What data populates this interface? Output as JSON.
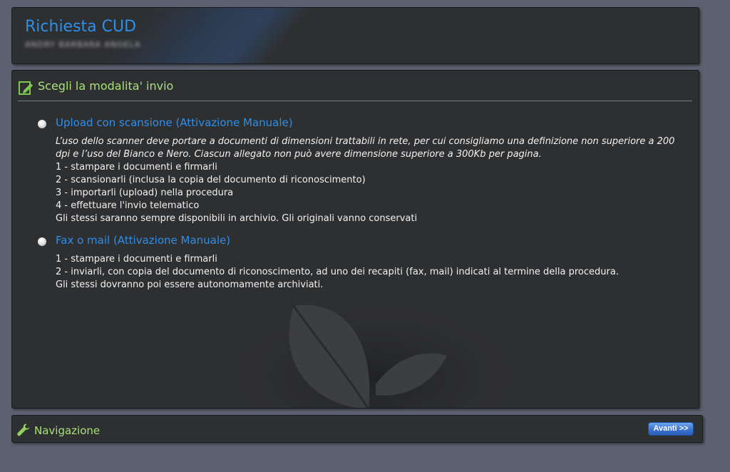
{
  "header": {
    "title": "Richiesta CUD",
    "user_name": "ANDRY BARBARA ANGELA"
  },
  "main": {
    "section_title": "Scegli la modalita' invio",
    "section_icon": "edit-document-icon",
    "options": [
      {
        "title": "Upload con scansione (Attivazione Manuale)",
        "selected": false,
        "intro": "L’uso dello scanner deve portare a documenti di dimensioni trattabili in rete, per cui consigliamo una definizione non superiore a 200 dpi e l’uso del Bianco e Nero. Ciascun allegato non può avere dimensione superiore a 300Kb per pagina.",
        "lines": [
          "1 - stampare i documenti e firmarli",
          "2 - scansionarli (inclusa la copia del documento di riconoscimento)",
          "3 - importarli (upload) nella procedura",
          "4 - effettuare l'invio telematico",
          "Gli stessi saranno sempre disponibili in archivio. Gli originali vanno conservati"
        ]
      },
      {
        "title": "Fax o mail (Attivazione Manuale)",
        "selected": false,
        "lines": [
          "1 - stampare i documenti e firmarli",
          "2 - inviarli, con copia del documento di riconoscimento, ad uno dei recapiti (fax, mail) indicati al termine della procedura.",
          "Gli stessi dovranno poi essere autonomamente archiviati."
        ]
      }
    ]
  },
  "nav": {
    "title": "Navigazione",
    "icon": "wrench-icon",
    "next_label": "Avanti >>"
  },
  "colors": {
    "background": "#5c6070",
    "panel": "#2e2f31",
    "title_blue": "#2f8fe8",
    "section_green": "#a8e07a",
    "button_blue": "#3b73d1"
  }
}
